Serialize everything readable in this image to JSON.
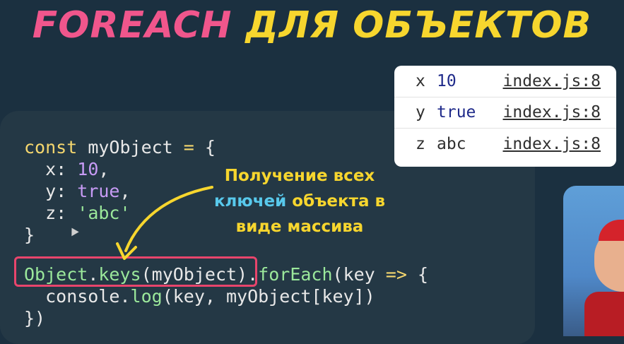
{
  "title": {
    "part1": "FOREACH",
    "part2": "ДЛЯ ОБЪЕКТОВ"
  },
  "code": {
    "l1_kw": "const",
    "l1_name": " myObject ",
    "l1_op": "=",
    "l1_brace": " {",
    "l2_key": "  x: ",
    "l2_val": "10",
    "l2_end": ",",
    "l3_key": "  y: ",
    "l3_val": "true",
    "l3_end": ",",
    "l4_key": "  z: ",
    "l4_val": "'abc'",
    "l5": "}",
    "l7_obj": "Object",
    "l7_dot": ".",
    "l7_keys": "keys",
    "l7_args": "(myObject)",
    "l7_dot2": ".",
    "l7_foreach": "forEach",
    "l7_rest": "(key ",
    "l7_arrow": "=>",
    "l7_brace": " {",
    "l8_pre": "  console.",
    "l8_log": "log",
    "l8_args": "(key, myObject[key])",
    "l9": "})"
  },
  "console": {
    "rows": [
      {
        "key": "x",
        "value": "10",
        "source": "index.js:8"
      },
      {
        "key": "y",
        "value": "true",
        "source": "index.js:8"
      },
      {
        "key": "z",
        "value": "abc",
        "source": "index.js:8"
      }
    ]
  },
  "annotation": {
    "line1": "Получение всех",
    "line2_cyan": "ключей",
    "line2_rest": " объекта в",
    "line3": "виде массива"
  },
  "colors": {
    "background": "#1b3040",
    "title_pink": "#f0568c",
    "title_yellow": "#f7d62e",
    "highlight_border": "#e8456c",
    "annotation_yellow": "#f7d62e",
    "annotation_cyan": "#58c9ec"
  },
  "icons": {
    "arrow": "curved-arrow-icon",
    "cursor": "mouse-cursor-icon"
  }
}
